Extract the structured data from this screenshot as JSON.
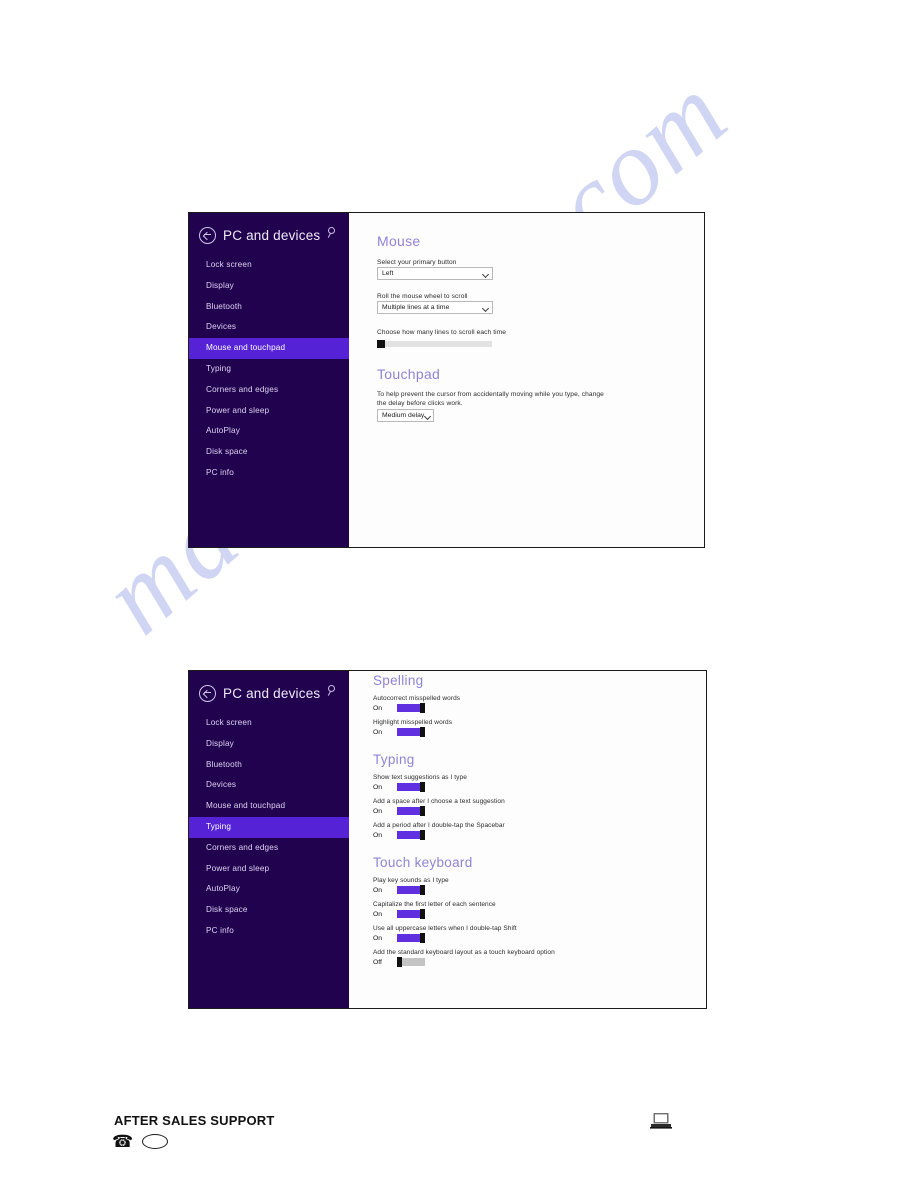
{
  "page": {
    "watermark": "manualshive.com"
  },
  "panel_mouse": {
    "sidebar": {
      "back_icon": "back-arrow-circle-icon",
      "title": "PC and devices",
      "search_icon": "search-icon",
      "items": [
        {
          "label": "Lock screen",
          "selected": false
        },
        {
          "label": "Display",
          "selected": false
        },
        {
          "label": "Bluetooth",
          "selected": false
        },
        {
          "label": "Devices",
          "selected": false
        },
        {
          "label": "Mouse and touchpad",
          "selected": true
        },
        {
          "label": "Typing",
          "selected": false
        },
        {
          "label": "Corners and edges",
          "selected": false
        },
        {
          "label": "Power and sleep",
          "selected": false
        },
        {
          "label": "AutoPlay",
          "selected": false
        },
        {
          "label": "Disk space",
          "selected": false
        },
        {
          "label": "PC info",
          "selected": false
        }
      ]
    },
    "content": {
      "mouse_heading": "Mouse",
      "primary_button_label": "Select your primary button",
      "primary_button_value": "Left",
      "wheel_label": "Roll the mouse wheel to scroll",
      "wheel_value": "Multiple lines at a time",
      "lines_label": "Choose how many lines to scroll each time",
      "lines_slider_percent": 0,
      "touchpad_heading": "Touchpad",
      "touchpad_description": "To help prevent the cursor from accidentally moving while you type, change the delay before clicks work.",
      "touchpad_delay_value": "Medium delay"
    }
  },
  "panel_typing": {
    "sidebar": {
      "back_icon": "back-arrow-circle-icon",
      "title": "PC and devices",
      "search_icon": "search-icon",
      "items": [
        {
          "label": "Lock screen",
          "selected": false
        },
        {
          "label": "Display",
          "selected": false
        },
        {
          "label": "Bluetooth",
          "selected": false
        },
        {
          "label": "Devices",
          "selected": false
        },
        {
          "label": "Mouse and touchpad",
          "selected": false
        },
        {
          "label": "Typing",
          "selected": true
        },
        {
          "label": "Corners and edges",
          "selected": false
        },
        {
          "label": "Power and sleep",
          "selected": false
        },
        {
          "label": "AutoPlay",
          "selected": false
        },
        {
          "label": "Disk space",
          "selected": false
        },
        {
          "label": "PC info",
          "selected": false
        }
      ]
    },
    "content": {
      "spelling_heading": "Spelling",
      "spelling_settings": [
        {
          "label": "Autocorrect misspelled words",
          "state": "On"
        },
        {
          "label": "Highlight misspelled words",
          "state": "On"
        }
      ],
      "typing_heading": "Typing",
      "typing_settings": [
        {
          "label": "Show text suggestions as I type",
          "state": "On"
        },
        {
          "label": "Add a space after I choose a text suggestion",
          "state": "On"
        },
        {
          "label": "Add a period after I double-tap the Spacebar",
          "state": "On"
        }
      ],
      "touch_keyboard_heading": "Touch keyboard",
      "touch_keyboard_settings": [
        {
          "label": "Play key sounds as I type",
          "state": "On"
        },
        {
          "label": "Capitalize the first letter of each sentence",
          "state": "On"
        },
        {
          "label": "Use all uppercase letters when I double-tap Shift",
          "state": "On"
        },
        {
          "label": "Add the standard keyboard layout as a touch keyboard option",
          "state": "Off"
        }
      ]
    }
  },
  "footer": {
    "title": "AFTER SALES SUPPORT",
    "phone_icon": "telephone-icon",
    "ellipse_icon": "ellipse-outline-icon",
    "laptop_icon": "laptop-icon"
  }
}
